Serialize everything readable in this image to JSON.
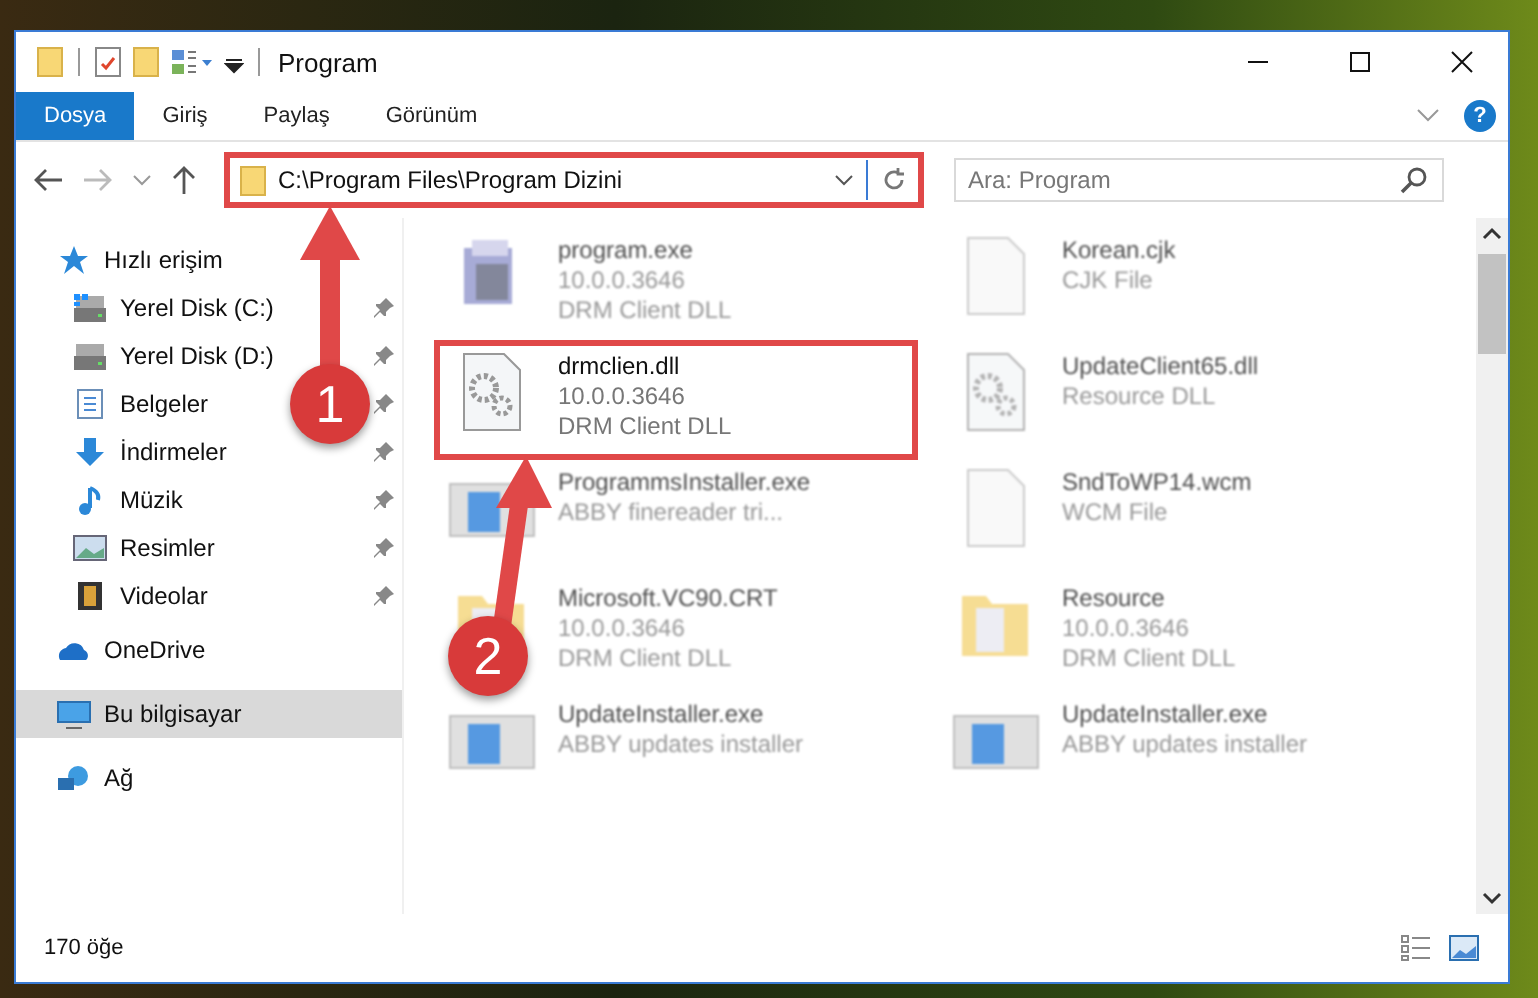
{
  "window": {
    "title": "Program"
  },
  "ribbon_tabs": [
    {
      "label": "Dosya",
      "selected": true
    },
    {
      "label": "Giriş",
      "selected": false
    },
    {
      "label": "Paylaş",
      "selected": false
    },
    {
      "label": "Görünüm",
      "selected": false
    }
  ],
  "help": "?",
  "address": {
    "path": "C:\\Program Files\\Program Dizini",
    "highlighted": true
  },
  "search": {
    "placeholder": "Ara: Program"
  },
  "nav": [
    {
      "label": "Hızlı erişim",
      "kind": "star",
      "selected": false,
      "children": [
        {
          "label": "Yerel Disk (C:)",
          "kind": "drive-c",
          "selected": false,
          "pinned": true
        },
        {
          "label": "Yerel Disk (D:)",
          "kind": "drive",
          "selected": false,
          "pinned": true
        },
        {
          "label": "Belgeler",
          "kind": "docs",
          "selected": false,
          "pinned": true
        },
        {
          "label": "İndirmeler",
          "kind": "download",
          "selected": false,
          "pinned": true
        },
        {
          "label": "Müzik",
          "kind": "music",
          "selected": false,
          "pinned": true
        },
        {
          "label": "Resimler",
          "kind": "pictures",
          "selected": false,
          "pinned": true
        },
        {
          "label": "Videolar",
          "kind": "videos",
          "selected": false,
          "pinned": true
        }
      ]
    },
    {
      "label": "OneDrive",
      "kind": "cloud",
      "selected": false
    },
    {
      "label": "Bu bilgisayar",
      "kind": "pc",
      "selected": true
    },
    {
      "label": "Ağ",
      "kind": "network",
      "selected": false
    }
  ],
  "files": [
    {
      "name": "program.exe",
      "details": [
        "10.0.0.3646",
        "DRM Client DLL"
      ],
      "kind": "app",
      "highlighted": false
    },
    {
      "name": "Korean.cjk",
      "details": [
        "CJK File"
      ],
      "kind": "blank",
      "highlighted": false
    },
    {
      "name": "drmclien.dll",
      "details": [
        "10.0.0.3646",
        "DRM Client DLL"
      ],
      "kind": "dll",
      "highlighted": true
    },
    {
      "name": "UpdateClient65.dll",
      "details": [
        "Resource DLL"
      ],
      "kind": "dll",
      "highlighted": false
    },
    {
      "name": "ProgrammsInstaller.exe",
      "details": [
        "ABBY finereader tri..."
      ],
      "kind": "installer",
      "highlighted": false
    },
    {
      "name": "SndToWP14.wcm",
      "details": [
        "WCM File"
      ],
      "kind": "blank",
      "highlighted": false
    },
    {
      "name": "Microsoft.VC90.CRT",
      "details": [
        "10.0.0.3646",
        "DRM Client DLL"
      ],
      "kind": "folder",
      "highlighted": false
    },
    {
      "name": "Resource",
      "details": [
        "10.0.0.3646",
        "DRM Client DLL"
      ],
      "kind": "folder",
      "highlighted": false
    },
    {
      "name": "UpdateInstaller.exe",
      "details": [
        "ABBY updates installer"
      ],
      "kind": "installer",
      "highlighted": false
    },
    {
      "name": "UpdateInstaller.exe",
      "details": [
        "ABBY updates installer"
      ],
      "kind": "installer",
      "highlighted": false
    }
  ],
  "status_bar": {
    "count": "170 öğe"
  },
  "annotations": [
    {
      "label": "1"
    },
    {
      "label": "2"
    }
  ]
}
